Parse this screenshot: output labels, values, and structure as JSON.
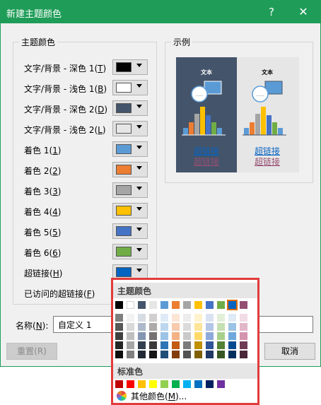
{
  "dialog": {
    "title": "新建主题颜色",
    "help_label": "?",
    "close_label": "✕"
  },
  "left_group": {
    "title": "主题颜色"
  },
  "rows": [
    {
      "label": "文字/背景 - 深色 1(",
      "key": "T",
      "close": ")",
      "color": "#000000"
    },
    {
      "label": "文字/背景 - 浅色 1(",
      "key": "B",
      "close": ")",
      "color": "#ffffff"
    },
    {
      "label": "文字/背景 - 深色 2(",
      "key": "D",
      "close": ")",
      "color": "#44546a"
    },
    {
      "label": "文字/背景 - 浅色 2(",
      "key": "L",
      "close": ")",
      "color": "#e7e6e6"
    },
    {
      "label": "着色 1(",
      "key": "1",
      "close": ")",
      "color": "#5b9bd5"
    },
    {
      "label": "着色 2(",
      "key": "2",
      "close": ")",
      "color": "#ed7d31"
    },
    {
      "label": "着色 3(",
      "key": "3",
      "close": ")",
      "color": "#a5a5a5"
    },
    {
      "label": "着色 4(",
      "key": "4",
      "close": ")",
      "color": "#ffc000"
    },
    {
      "label": "着色 5(",
      "key": "5",
      "close": ")",
      "color": "#4472c4"
    },
    {
      "label": "着色 6(",
      "key": "6",
      "close": ")",
      "color": "#70ad47"
    },
    {
      "label": "超链接(",
      "key": "H",
      "close": ")",
      "color": "#0563c1"
    },
    {
      "label": "已访问的超链接(",
      "key": "F",
      "close": ")",
      "color": "#954f72"
    }
  ],
  "right_group": {
    "title": "示例"
  },
  "preview": {
    "text_label": "文本",
    "hyperlink": "超链接",
    "visited": "超链接",
    "colors": {
      "dark_bg": "#44546a",
      "light_bg": "#e7e6e6"
    }
  },
  "name_field": {
    "label": "名称(",
    "key": "N",
    "close": "):",
    "value": "自定义 1"
  },
  "buttons": {
    "reset": "重置(R)",
    "cancel": "取消"
  },
  "popup": {
    "theme_header": "主题颜色",
    "standard_header": "标准色",
    "more_label": "其他颜色(",
    "more_key": "M",
    "more_close": ")...",
    "theme_colors": [
      "#000000",
      "#ffffff",
      "#44546a",
      "#e7e6e6",
      "#5b9bd5",
      "#ed7d31",
      "#a5a5a5",
      "#ffc000",
      "#4472c4",
      "#70ad47",
      "#0563c1",
      "#954f72"
    ],
    "shades": [
      [
        "#7f7f7f",
        "#595959",
        "#404040",
        "#262626",
        "#0d0d0d"
      ],
      [
        "#f2f2f2",
        "#d9d9d9",
        "#bfbfbf",
        "#a6a6a6",
        "#808080"
      ],
      [
        "#d6dce4",
        "#adb9ca",
        "#8496b0",
        "#333f4f",
        "#222a35"
      ],
      [
        "#d0cece",
        "#aeaaaa",
        "#757171",
        "#3a3838",
        "#171616"
      ],
      [
        "#deebf6",
        "#bdd7ee",
        "#9dc3e6",
        "#2e75b5",
        "#1f4e79"
      ],
      [
        "#fbe5d5",
        "#f7cbac",
        "#f4b183",
        "#c55a11",
        "#833c0b"
      ],
      [
        "#ededed",
        "#dbdbdb",
        "#c9c9c9",
        "#7b7b7b",
        "#525252"
      ],
      [
        "#fff2cc",
        "#fee599",
        "#ffd966",
        "#bf9000",
        "#7f6000"
      ],
      [
        "#d9e2f3",
        "#b4c6e7",
        "#8eaadb",
        "#2f5496",
        "#1f3864"
      ],
      [
        "#e2efd9",
        "#c5e0b3",
        "#a8d08d",
        "#538135",
        "#375623"
      ],
      [
        "#deeaf6",
        "#9cc2e5",
        "#6fa8dc",
        "#034a8f",
        "#022f5c"
      ],
      [
        "#f1dbe4",
        "#e2b7c8",
        "#d494ad",
        "#6f3b55",
        "#4a2739"
      ]
    ],
    "standard_colors": [
      "#c00000",
      "#ff0000",
      "#ffc000",
      "#ffff00",
      "#92d050",
      "#00b050",
      "#00b0f0",
      "#0070c0",
      "#002060",
      "#7030a0"
    ],
    "selected_index": 10
  }
}
